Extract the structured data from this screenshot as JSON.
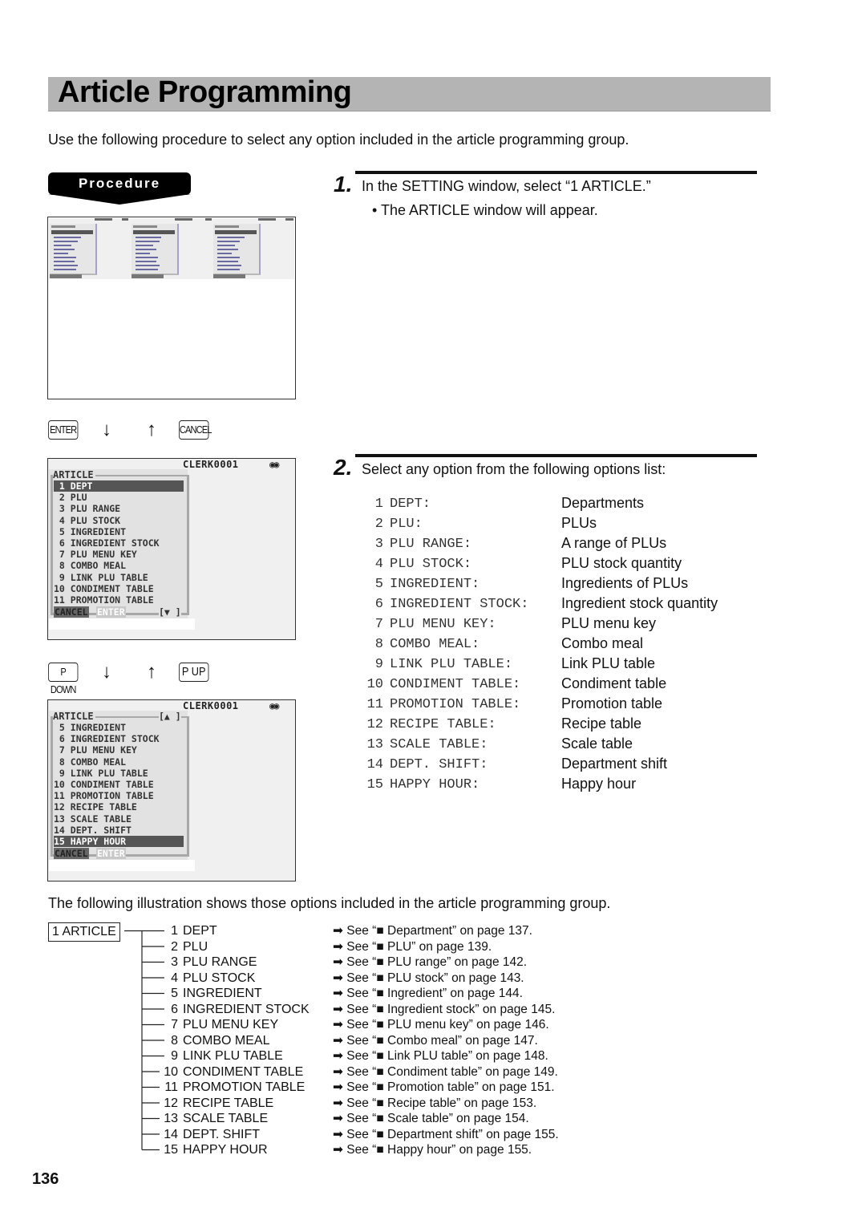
{
  "page": {
    "title": "Article Programming",
    "intro": "Use the following procedure to select any option included in the article programming group.",
    "procedure_label": "Procedure",
    "page_number": "136",
    "illustration_caption": "The following illustration shows those options included in the article programming group."
  },
  "keys": {
    "row1": {
      "left_key": "ENTER",
      "down_arrow": "↓",
      "up_arrow": "↑",
      "right_key": "CANCEL"
    },
    "row2": {
      "left_key": "P DOWN",
      "down_arrow": "↓",
      "up_arrow": "↑",
      "right_key": "P UP"
    }
  },
  "screens": {
    "screen2": {
      "clerk": "CLERK0001",
      "eyes": "◉◉",
      "panel_title": "ARTICLE",
      "scroll_indicator": "[▼ ]",
      "items": [
        " 1 DEPT",
        " 2 PLU",
        " 3 PLU RANGE",
        " 4 PLU STOCK",
        " 5 INGREDIENT",
        " 6 INGREDIENT STOCK",
        " 7 PLU MENU KEY",
        " 8 COMBO MEAL",
        " 9 LINK PLU TABLE",
        "10 CONDIMENT TABLE",
        "11 PROMOTION TABLE"
      ],
      "selected_index": 0,
      "cancel": "CANCEL",
      "enter": "ENTER"
    },
    "screen3": {
      "clerk": "CLERK0001",
      "eyes": "◉◉",
      "panel_title": "ARTICLE",
      "scroll_indicator": "[▲ ]",
      "items": [
        " 5 INGREDIENT",
        " 6 INGREDIENT STOCK",
        " 7 PLU MENU KEY",
        " 8 COMBO MEAL",
        " 9 LINK PLU TABLE",
        "10 CONDIMENT TABLE",
        "11 PROMOTION TABLE",
        "12 RECIPE TABLE",
        "13 SCALE TABLE",
        "14 DEPT. SHIFT",
        "15 HAPPY HOUR"
      ],
      "selected_index": 10,
      "cancel": "CANCEL",
      "enter": "ENTER"
    }
  },
  "steps": [
    {
      "number": "1.",
      "text": "In the SETTING window, select “1 ARTICLE.”",
      "bullet": "• The ARTICLE window will appear."
    },
    {
      "number": "2.",
      "text": "Select any option from the following options list:"
    }
  ],
  "options": [
    {
      "num": "1",
      "code": "DEPT:",
      "desc": "Departments"
    },
    {
      "num": "2",
      "code": "PLU:",
      "desc": "PLUs"
    },
    {
      "num": "3",
      "code": "PLU RANGE:",
      "desc": "A range of PLUs"
    },
    {
      "num": "4",
      "code": "PLU STOCK:",
      "desc": "PLU stock quantity"
    },
    {
      "num": "5",
      "code": "INGREDIENT:",
      "desc": "Ingredients of PLUs"
    },
    {
      "num": "6",
      "code": "INGREDIENT STOCK:",
      "desc": "Ingredient stock quantity"
    },
    {
      "num": "7",
      "code": "PLU MENU KEY:",
      "desc": "PLU menu key"
    },
    {
      "num": "8",
      "code": "COMBO MEAL:",
      "desc": "Combo meal"
    },
    {
      "num": "9",
      "code": "LINK PLU TABLE:",
      "desc": "Link PLU table"
    },
    {
      "num": "10",
      "code": "CONDIMENT TABLE:",
      "desc": "Condiment table"
    },
    {
      "num": "11",
      "code": "PROMOTION TABLE:",
      "desc": "Promotion table"
    },
    {
      "num": "12",
      "code": "RECIPE TABLE:",
      "desc": "Recipe table"
    },
    {
      "num": "13",
      "code": "SCALE TABLE:",
      "desc": "Scale table"
    },
    {
      "num": "14",
      "code": "DEPT. SHIFT:",
      "desc": "Department shift"
    },
    {
      "num": "15",
      "code": "HAPPY HOUR:",
      "desc": "Happy hour"
    }
  ],
  "tree": {
    "root": "1 ARTICLE",
    "items": [
      {
        "num": "1",
        "label": "DEPT",
        "ref": "➡ See “■ Department” on page 137."
      },
      {
        "num": "2",
        "label": "PLU",
        "ref": "➡ See “■ PLU” on page 139."
      },
      {
        "num": "3",
        "label": "PLU RANGE",
        "ref": "➡ See “■ PLU range” on page 142."
      },
      {
        "num": "4",
        "label": "PLU STOCK",
        "ref": "➡ See “■ PLU stock” on page 143."
      },
      {
        "num": "5",
        "label": "INGREDIENT",
        "ref": "➡ See “■ Ingredient” on page 144."
      },
      {
        "num": "6",
        "label": "INGREDIENT STOCK",
        "ref": "➡ See “■ Ingredient stock” on page 145."
      },
      {
        "num": "7",
        "label": "PLU MENU KEY",
        "ref": "➡ See “■ PLU menu key” on page 146."
      },
      {
        "num": "8",
        "label": "COMBO MEAL",
        "ref": "➡ See “■ Combo meal” on page 147."
      },
      {
        "num": "9",
        "label": "LINK PLU TABLE",
        "ref": "➡ See “■ Link PLU table” on page 148."
      },
      {
        "num": "10",
        "label": "CONDIMENT TABLE",
        "ref": "➡ See “■ Condiment table” on page 149."
      },
      {
        "num": "11",
        "label": "PROMOTION TABLE",
        "ref": "➡ See “■ Promotion table” on page 151."
      },
      {
        "num": "12",
        "label": "RECIPE TABLE",
        "ref": "➡ See “■ Recipe table” on page 153."
      },
      {
        "num": "13",
        "label": "SCALE TABLE",
        "ref": "➡ See “■ Scale table” on page 154."
      },
      {
        "num": "14",
        "label": "DEPT. SHIFT",
        "ref": "➡ See “■ Department shift” on page 155."
      },
      {
        "num": "15",
        "label": "HAPPY HOUR",
        "ref": "➡ See “■ Happy hour” on page 155."
      }
    ]
  }
}
